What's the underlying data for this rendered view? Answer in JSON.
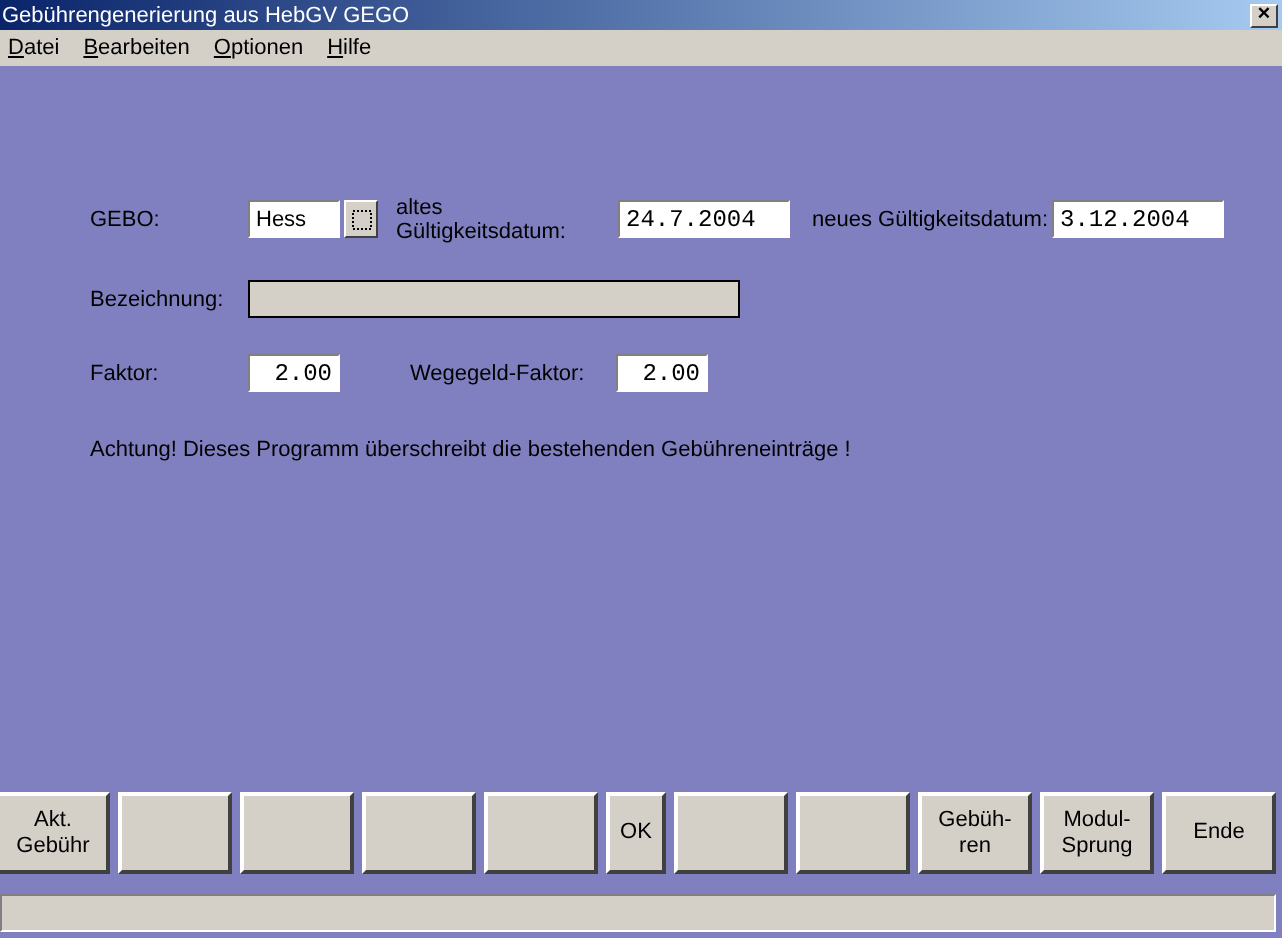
{
  "window": {
    "title": "Gebührengenerierung aus HebGV GEGO",
    "close": "×"
  },
  "menu": [
    "Datei",
    "Bearbeiten",
    "Optionen",
    "Hilfe"
  ],
  "form": {
    "gebo_label": "GEBO:",
    "gebo_value": "Hess",
    "old_date_label": "altes Gültigkeitsdatum:",
    "old_date": "24.7.2004",
    "new_date_label": "neues Gültigkeitsdatum:",
    "new_date": "3.12.2004",
    "bezeichnung_label": "Bezeichnung:",
    "faktor_label": "Faktor:",
    "faktor": "2.00",
    "wegegeld_label": "Wegegeld-Faktor:",
    "wegegeld": "2.00",
    "warning": "Achtung! Dieses Programm überschreibt die bestehenden Gebühreneinträge !"
  },
  "buttons": [
    {
      "kind": "text",
      "label": "Akt.\nGebühr"
    },
    {
      "kind": "blank"
    },
    {
      "kind": "blank"
    },
    {
      "kind": "blank"
    },
    {
      "kind": "blank"
    },
    {
      "kind": "narrow",
      "label": "OK"
    },
    {
      "kind": "blank"
    },
    {
      "kind": "blank"
    },
    {
      "kind": "text",
      "label": "Gebüh-\nren"
    },
    {
      "kind": "text",
      "label": "Modul-\nSprung"
    },
    {
      "kind": "text",
      "label": "Ende"
    }
  ]
}
